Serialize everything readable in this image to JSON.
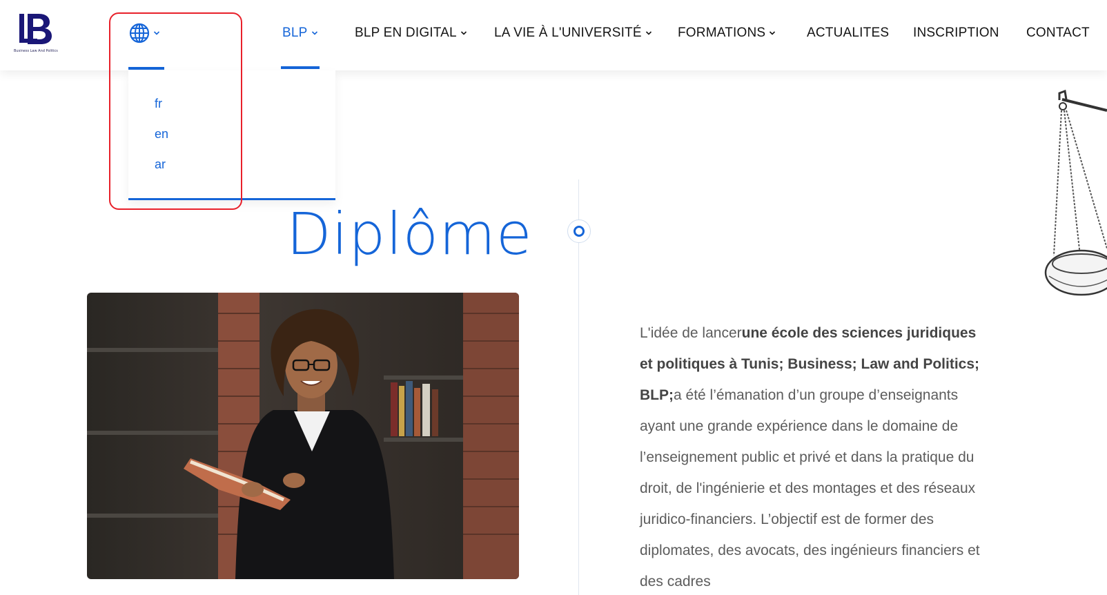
{
  "logo": {
    "caption": "Business Law And Politics",
    "icon": "blp-logo"
  },
  "language": {
    "icon": "globe-icon",
    "options": [
      "fr",
      "en",
      "ar"
    ]
  },
  "nav": {
    "items": [
      {
        "label": "BLP",
        "has_dropdown": true,
        "active": true
      },
      {
        "label": "BLP EN DIGITAL",
        "has_dropdown": true
      },
      {
        "label": "LA VIE À L'UNIVERSITÉ",
        "has_dropdown": true
      },
      {
        "label": "FORMATIONS",
        "has_dropdown": true
      },
      {
        "label": "ACTUALITES",
        "has_dropdown": false
      },
      {
        "label": "INSCRIPTION",
        "has_dropdown": false
      },
      {
        "label": "CONTACT",
        "has_dropdown": false
      }
    ]
  },
  "page": {
    "title": "Diplôme"
  },
  "intro": {
    "part1": "L'idée de lancer",
    "bold": "une école des sciences juridiques et politiques à Tunis; Business; Law and Politics; BLP;",
    "part2": "a été l’émanation d’un groupe d’enseignants ayant une grande expérience dans le domaine de l’enseignement public et privé et dans la pratique du droit, de l'ingénierie et des montages et des réseaux juridico-financiers. L’objectif est de former des diplomates, des avocats, des ingénieurs financiers et des cadres"
  },
  "colors": {
    "accent": "#1565d8",
    "highlight": "#e8202a",
    "text": "#5c5c5c"
  }
}
